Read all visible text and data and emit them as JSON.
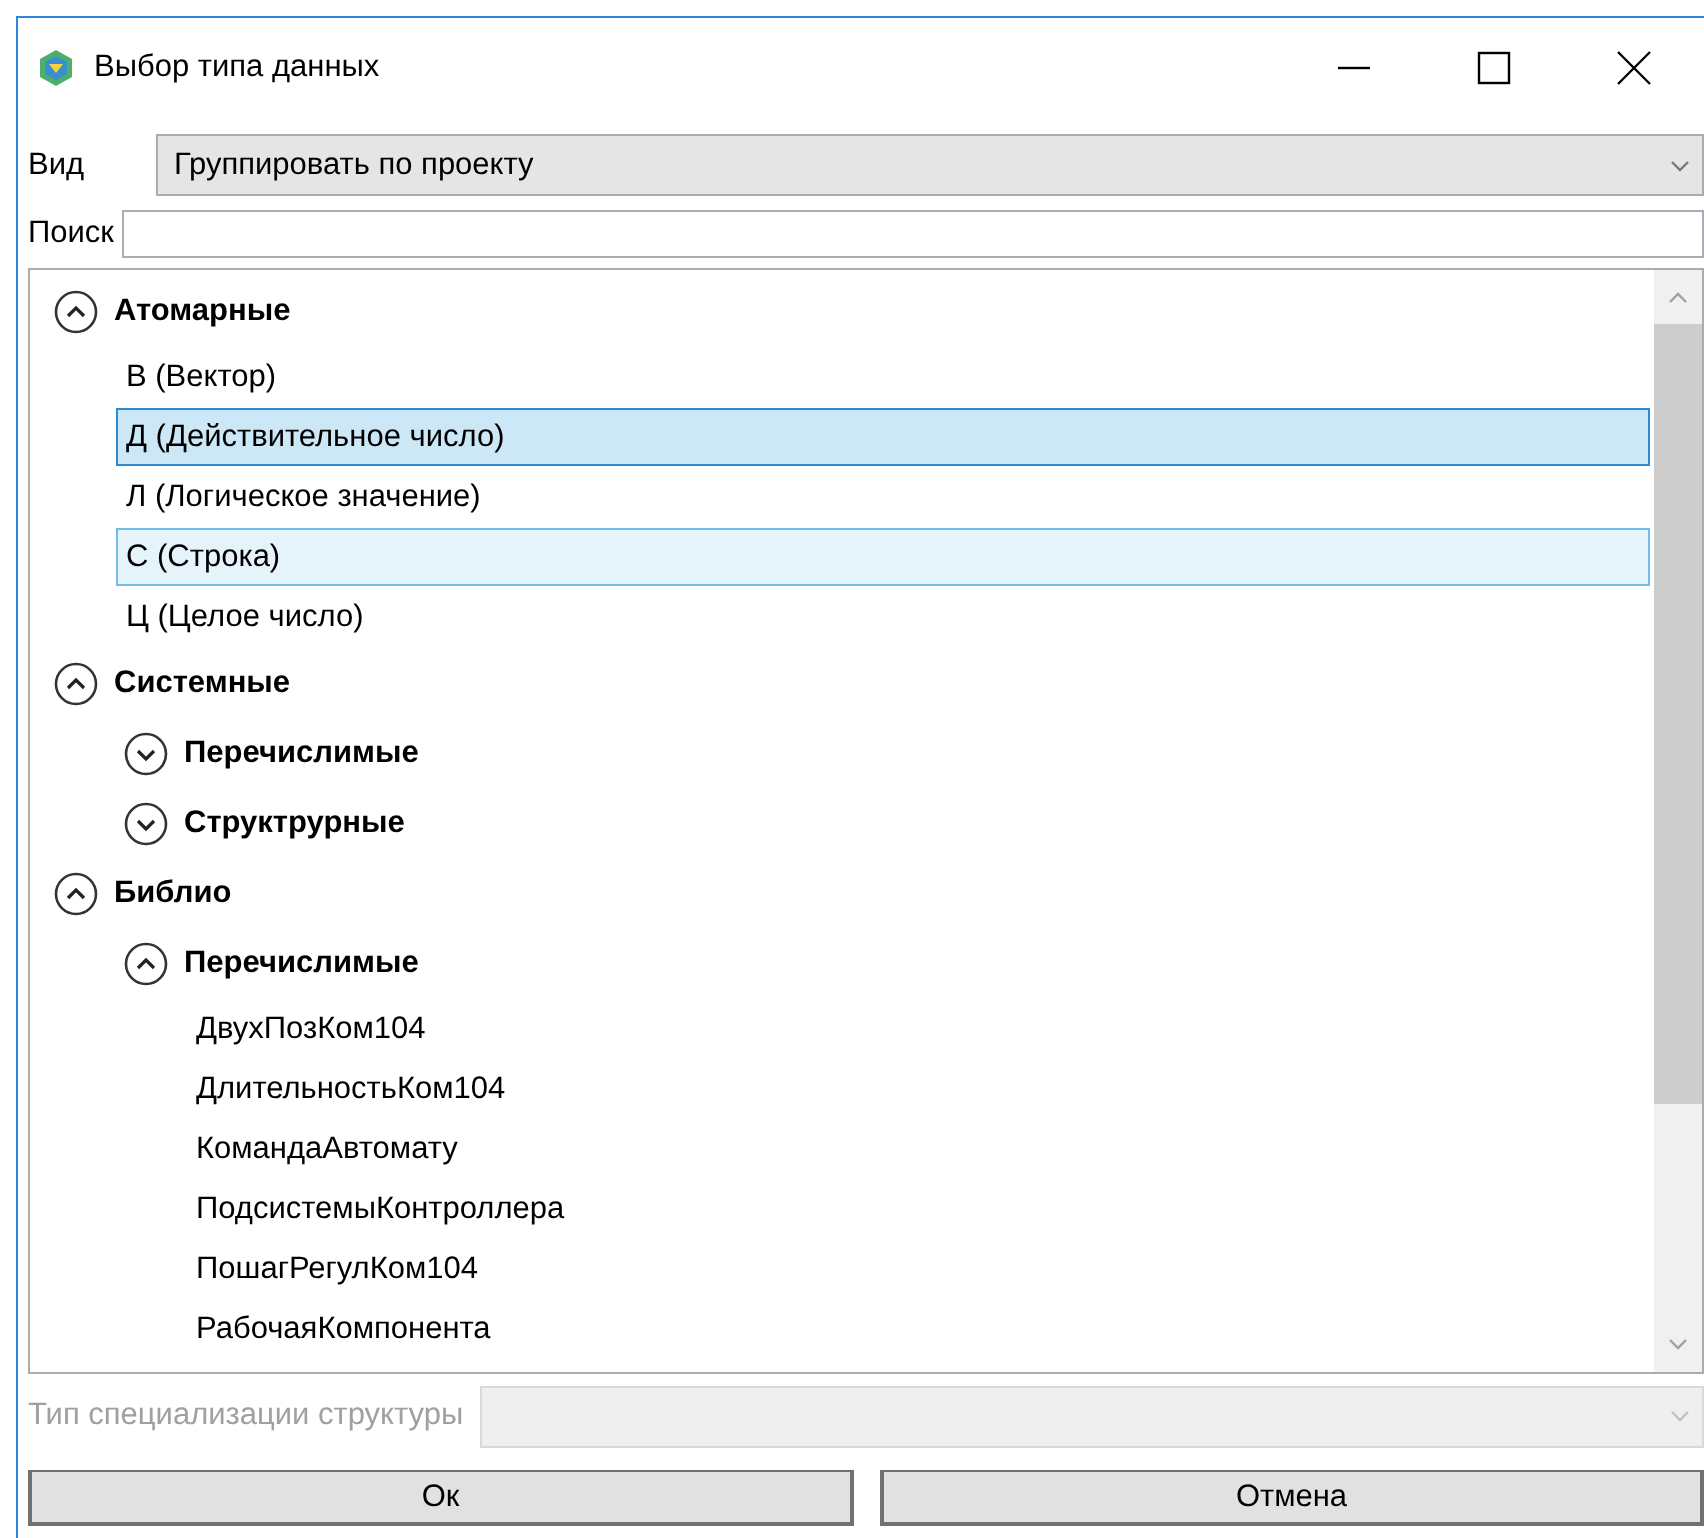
{
  "window": {
    "title": "Выбор типа данных"
  },
  "view": {
    "label": "Вид",
    "value": "Группировать по проекту"
  },
  "search": {
    "label": "Поиск"
  },
  "tree": [
    {
      "kind": "group",
      "label": "Атомарные",
      "expanded": true,
      "children": [
        {
          "kind": "item",
          "label": "В (Вектор)",
          "selected": false,
          "hovered": false
        },
        {
          "kind": "item",
          "label": "Д (Действительное число)",
          "selected": true,
          "hovered": false
        },
        {
          "kind": "item",
          "label": "Л (Логическое значение)",
          "selected": false,
          "hovered": false
        },
        {
          "kind": "item",
          "label": "С (Строка)",
          "selected": false,
          "hovered": true
        },
        {
          "kind": "item",
          "label": "Ц (Целое число)",
          "selected": false,
          "hovered": false
        }
      ]
    },
    {
      "kind": "group",
      "label": "Системные",
      "expanded": true,
      "children": [
        {
          "kind": "group",
          "label": "Перечислимые",
          "expanded": false
        },
        {
          "kind": "group",
          "label": "Структрурные",
          "expanded": false
        }
      ]
    },
    {
      "kind": "group",
      "label": "Библио",
      "expanded": true,
      "children": [
        {
          "kind": "group",
          "label": "Перечислимые",
          "expanded": true,
          "children": [
            {
              "kind": "item",
              "label": "ДвухПозКом104",
              "selected": false,
              "hovered": false
            },
            {
              "kind": "item",
              "label": "ДлительностьКом104",
              "selected": false,
              "hovered": false
            },
            {
              "kind": "item",
              "label": "КомандаАвтомату",
              "selected": false,
              "hovered": false
            },
            {
              "kind": "item",
              "label": "ПодсистемыКонтроллера",
              "selected": false,
              "hovered": false
            },
            {
              "kind": "item",
              "label": "ПошагРегулКом104",
              "selected": false,
              "hovered": false
            },
            {
              "kind": "item",
              "label": "РабочаяКомпонента",
              "selected": false,
              "hovered": false
            }
          ]
        }
      ]
    }
  ],
  "specialization": {
    "label": "Тип специализации структуры",
    "disabled": true
  },
  "buttons": [
    "Ок",
    "Отмена"
  ]
}
